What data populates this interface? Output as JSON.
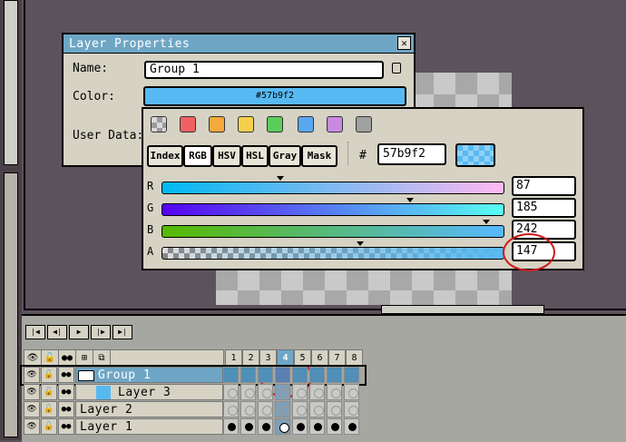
{
  "dialog": {
    "title": "Layer Properties",
    "close_glyph": "✕",
    "name_label": "Name:",
    "name_value": "Group 1",
    "color_label": "Color:",
    "color_value": "#57b9f2",
    "userdata_label": "User Data:"
  },
  "color_popup": {
    "swatches": [
      "#d0d0d0",
      "#f06262",
      "#f5a83c",
      "#f4d04a",
      "#5ccc5c",
      "#5aa8f0",
      "#c88ae0",
      "#a0a0a0"
    ],
    "modes": [
      "Index",
      "RGB",
      "HSV",
      "HSL",
      "Gray",
      "Mask"
    ],
    "active_mode": "RGB",
    "hash": "#",
    "hex": "57b9f2",
    "channels": [
      {
        "label": "R",
        "value": "87"
      },
      {
        "label": "G",
        "value": "185"
      },
      {
        "label": "B",
        "value": "242"
      },
      {
        "label": "A",
        "value": "147"
      }
    ]
  },
  "timeline": {
    "nav_icons": [
      "first-frame",
      "prev-frame",
      "play",
      "next-frame",
      "last-frame"
    ],
    "frames": [
      "1",
      "2",
      "3",
      "4",
      "5",
      "6",
      "7",
      "8"
    ],
    "active_frame": "4",
    "layers": [
      {
        "name": "Group 1",
        "type": "group",
        "selected": true
      },
      {
        "name": "Layer 3",
        "type": "child"
      },
      {
        "name": "Layer 2",
        "type": "layer"
      },
      {
        "name": "Layer 1",
        "type": "layer"
      }
    ]
  },
  "colors": {
    "accent": "#57b9f2",
    "title_bar": "#6fa6c6",
    "panel": "#d6d2c4",
    "annotation_circle": "#d01818"
  }
}
